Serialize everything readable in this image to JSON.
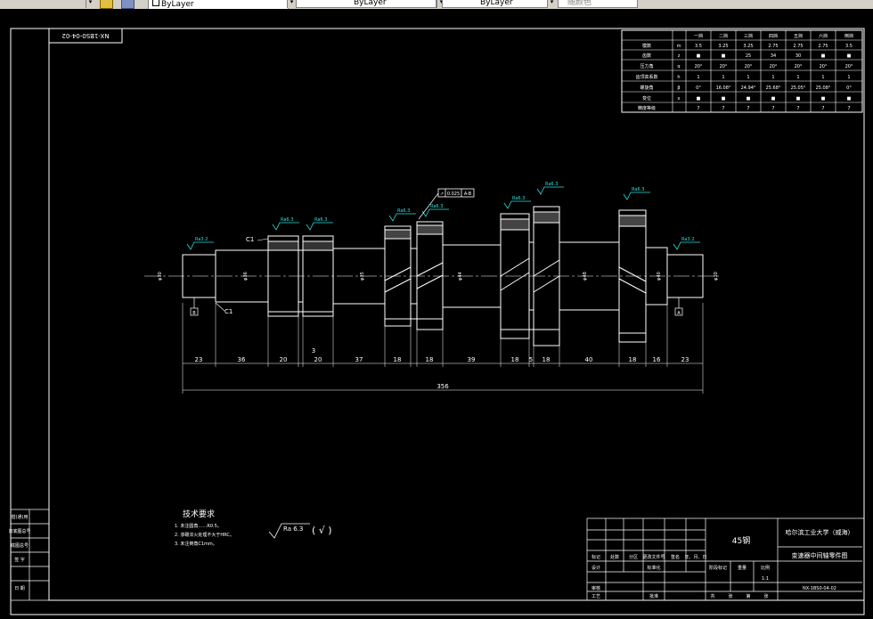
{
  "toolbar": {
    "layer_combo_1": "ByLayer",
    "layer_combo_2": "ByLayer",
    "layer_combo_3": "ByLayer",
    "color_combo": "随颜色"
  },
  "drawing_code_box": "NX-1BS0-04-02",
  "roughness_labels": [
    "Ra3.2",
    "Ra6.3",
    "Ra6.3",
    "Ra6.3",
    "Ra6.3",
    "Ra6.3",
    "Ra6.3",
    "Ra6.3",
    "Ra3.2"
  ],
  "tolerance_frame": {
    "value": "0.025",
    "datum": "A-B"
  },
  "chamfers": [
    "C1",
    "C1"
  ],
  "datums": [
    "B",
    "A"
  ],
  "diameters": [
    "φ30",
    "φ36",
    "φ35",
    "φ44",
    "φ48",
    "φ40",
    "φ30"
  ],
  "length_dims": [
    "23",
    "36",
    "20",
    "3",
    "20",
    "37",
    "18",
    "18",
    "39",
    "18",
    "5",
    "18",
    "40",
    "18",
    "16",
    "23"
  ],
  "total_length": "356",
  "gear_table": {
    "headers": [
      "一挡",
      "二挡",
      "三挡",
      "四挡",
      "五挡",
      "六挡",
      "倒挡"
    ],
    "rows": [
      {
        "label": "模数",
        "sym": "m",
        "vals": [
          "3.5",
          "3.25",
          "3.25",
          "2.75",
          "2.75",
          "2.75",
          "3.5"
        ]
      },
      {
        "label": "齿数",
        "sym": "z",
        "vals": [
          "■",
          "■",
          "25",
          "34",
          "30",
          "■",
          "■"
        ]
      },
      {
        "label": "压力角",
        "sym": "α",
        "vals": [
          "20°",
          "20°",
          "20°",
          "20°",
          "20°",
          "20°",
          "20°"
        ]
      },
      {
        "label": "齿顶高系数",
        "sym": "h",
        "vals": [
          "1",
          "1",
          "1",
          "1",
          "1",
          "1",
          "1"
        ]
      },
      {
        "label": "螺旋角",
        "sym": "β",
        "vals": [
          "0°",
          "16.08°",
          "24.94°",
          "25.68°",
          "25.05°",
          "25.08°",
          "0°"
        ]
      },
      {
        "label": "变位",
        "sym": "x",
        "vals": [
          "■",
          "■",
          "■",
          "■",
          "■",
          "■",
          "■"
        ]
      },
      {
        "label": "精度等级",
        "sym": "",
        "vals": [
          "7",
          "7",
          "7",
          "7",
          "7",
          "7",
          "7"
        ]
      }
    ]
  },
  "tech_req": {
    "title": "技术要求",
    "items": [
      "1. 未注圆角……R0.5。",
      "2. 渗碳淬火处理不大于HRC。",
      "3. 未注倒角C1mm。"
    ]
  },
  "general_roughness": {
    "value": "Ra 6.3",
    "paren": "( √ )"
  },
  "title_block": {
    "material": "45钢",
    "school": "哈尔滨工业大学（威海）",
    "drawing_name": "变速器中间轴零件图",
    "drawing_no": "NX-1BS0-04-02",
    "scale": "1:1",
    "labels": [
      "标记",
      "处数",
      "分区",
      "更改文件号",
      "签名",
      "年、月、日",
      "设计",
      "审核",
      "工艺",
      "批准",
      "标准化",
      "阶段标记",
      "重量",
      "比例",
      "共",
      "张",
      "第",
      "张"
    ]
  },
  "left_strip": [
    "借(通)用",
    "旧底图总号",
    "底图总号",
    "签 字",
    "日 期"
  ]
}
